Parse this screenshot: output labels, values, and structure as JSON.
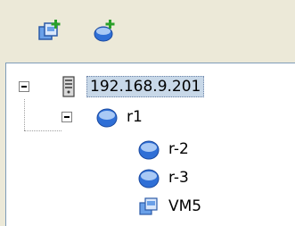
{
  "toolbar": {
    "buttons": [
      {
        "icon": "add-vm-icon"
      },
      {
        "icon": "add-router-icon"
      }
    ]
  },
  "tree": {
    "root": {
      "label": "192.168.9.201",
      "icon": "server-icon",
      "expanded": true,
      "selected": true
    },
    "router": {
      "label": "r1",
      "icon": "router-icon",
      "expanded": true
    },
    "children": [
      {
        "label": "r-2",
        "icon": "router-icon"
      },
      {
        "label": "r-3",
        "icon": "router-icon"
      },
      {
        "label": "VM5",
        "icon": "vm-icon"
      }
    ]
  },
  "colors": {
    "router_blue": "#2f6fd6",
    "selection_bg": "#c8d8e8",
    "window_bg": "#ece9d8",
    "add_green": "#2aa02a"
  }
}
